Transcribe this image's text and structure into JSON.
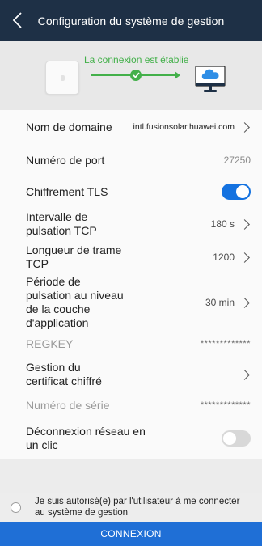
{
  "header": {
    "title": "Configuration du système de gestion",
    "back_icon": "chevron-left-icon"
  },
  "banner": {
    "status_text": "La connexion est établie",
    "status_color": "#43b04a",
    "device_icon": "router-icon",
    "server_icon": "cloud-monitor-icon"
  },
  "settings": {
    "domain": {
      "label": "Nom de domaine",
      "value": "intl.fusionsolar.huawei.com"
    },
    "port": {
      "label": "Numéro de port",
      "value": "27250"
    },
    "tls": {
      "label": "Chiffrement TLS",
      "enabled": true
    },
    "heartbeat": {
      "label_line1": "Intervalle de",
      "label_line2": "pulsation TCP",
      "value": "180 s"
    },
    "frame": {
      "label_line1": "Longueur de trame",
      "label_line2": "TCP",
      "value": "1200"
    },
    "app_heartbeat": {
      "label_line1": "Période de",
      "label_line2": "pulsation au niveau",
      "label_line3": "de la couche",
      "label_line4": "d'application",
      "value": "30 min"
    },
    "regkey": {
      "label": "REGKEY",
      "value": "*************"
    },
    "cert": {
      "label_line1": "Gestion du",
      "label_line2": "certificat chiffré"
    },
    "serial": {
      "label": "Numéro de série",
      "value": "*************"
    },
    "one_click": {
      "label_line1": "Déconnexion réseau en",
      "label_line2": "un clic",
      "enabled": false
    }
  },
  "consent": {
    "text_line1": "Je suis autorisé(e) par l'utilisateur à me connecter",
    "text_line2": "au système de gestion"
  },
  "connect_button": {
    "label": "CONNEXION",
    "color": "#1f6fd6"
  },
  "colors": {
    "header_bg": "#1e3046",
    "toggle_on": "#1472e0"
  }
}
